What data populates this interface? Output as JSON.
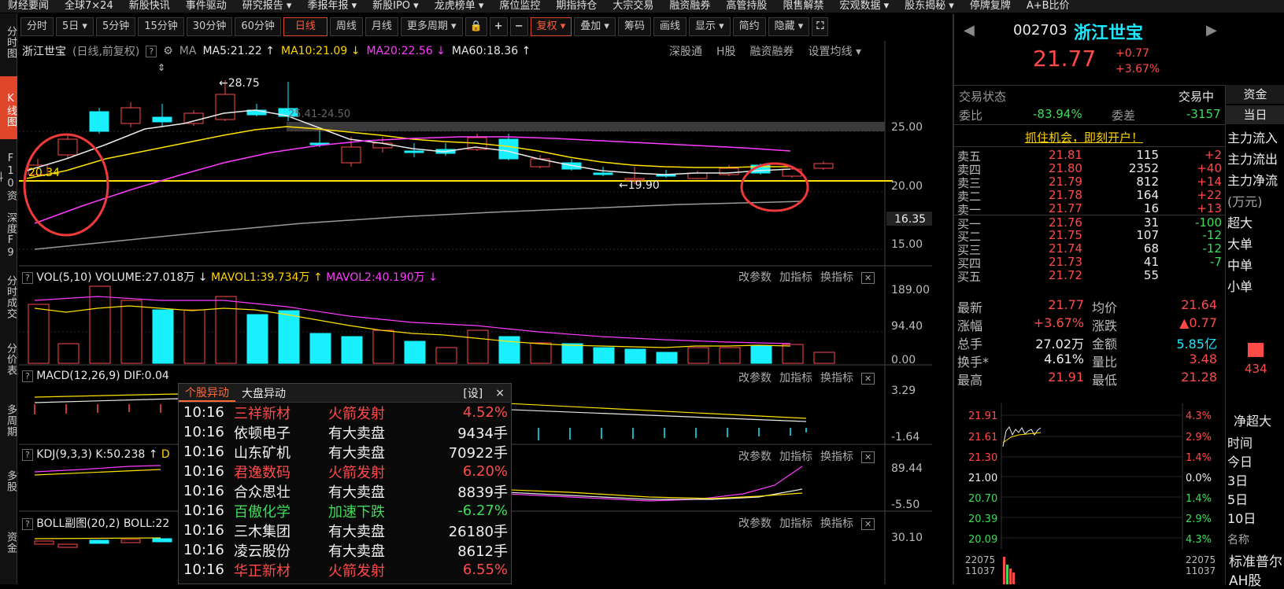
{
  "top_nav": [
    "财经要闻",
    "全球7×24",
    "新股快讯",
    "事件驱动",
    "研究报告 ▾",
    "季报年报 ▾",
    "新股IPO ▾",
    "龙虎榜单 ▾",
    "席位监控",
    "期指持仓",
    "大宗交易",
    "融资融券",
    "高管持股",
    "限售解禁",
    "宏观数据 ▾",
    "股东揭秘 ▾",
    "停牌复牌",
    "A+B比价"
  ],
  "left_tabs": [
    {
      "label": "分时图",
      "active": false
    },
    {
      "label": "K线图",
      "active": true
    },
    {
      "label": "F10资料",
      "active": false
    },
    {
      "label": "深度F9",
      "active": false
    },
    {
      "label": "分时成交",
      "active": false
    },
    {
      "label": "分价表",
      "active": false
    },
    {
      "label": "多周期",
      "active": false
    },
    {
      "label": "多股",
      "active": false
    },
    {
      "label": "资金",
      "active": false
    }
  ],
  "toolbar": [
    {
      "label": "分时",
      "active": false
    },
    {
      "label": "5日 ▾",
      "active": false
    },
    {
      "label": "5分钟",
      "active": false
    },
    {
      "label": "15分钟",
      "active": false
    },
    {
      "label": "30分钟",
      "active": false
    },
    {
      "label": "60分钟",
      "active": false
    },
    {
      "label": "日线",
      "active": true
    },
    {
      "label": "周线",
      "active": false
    },
    {
      "label": "月线",
      "active": false
    },
    {
      "label": "更多周期 ▾",
      "active": false
    },
    {
      "label": "🔒",
      "active": false
    },
    {
      "label": "+",
      "active": false
    },
    {
      "label": "−",
      "active": false
    },
    {
      "label": "复权 ▾",
      "active": true
    },
    {
      "label": "叠加 ▾",
      "active": false
    },
    {
      "label": "筹码",
      "active": false
    },
    {
      "label": "画线",
      "active": false
    },
    {
      "label": "显示 ▾",
      "active": false
    },
    {
      "label": "简约",
      "active": false
    },
    {
      "label": "隐藏 ▾",
      "active": false
    },
    {
      "label": "⛶",
      "active": false
    }
  ],
  "kline_header": {
    "name": "浙江世宝",
    "period": "(日线,前复权)",
    "ma_label": "MA",
    "ma5": "MA5:21.22 ↑",
    "ma10": "MA10:21.09 ↓",
    "ma20": "MA20:22.56 ↓",
    "ma60": "MA60:18.36 ↑",
    "links": [
      "深股通",
      "H股",
      "融资融券",
      "设置均线 ▾"
    ]
  },
  "kline_annotations": {
    "high": "←28.75",
    "low": "←19.90",
    "left": "20.34",
    "range": "25.41-24.50",
    "price_labels": [
      "25.00",
      "20.00",
      "16.35",
      "15.00"
    ]
  },
  "vol_panel": {
    "label": "VOL(5,10)",
    "volume": "VOLUME:27.018万 ↓",
    "mavol1": "MAVOL1:39.734万 ↑",
    "mavol2": "MAVOL2:40.190万 ↓",
    "axis": [
      "189.00",
      "94.40",
      "0.00"
    ]
  },
  "macd_panel": {
    "label": "MACD(12,26,9)",
    "dif": "DIF:0.04",
    "axis": [
      "3.29",
      "-1.64"
    ]
  },
  "kdj_panel": {
    "label": "KDJ(9,3,3)",
    "k": "K:50.238 ↑",
    "d": "D",
    "axis": [
      "89.44",
      "-5.50"
    ]
  },
  "boll_panel": {
    "label": "BOLL副图(20,2)",
    "boll": "BOLL:22",
    "axis": [
      "30.10"
    ]
  },
  "panel_buttons": [
    "改参数",
    "加指标",
    "换指标",
    "✕"
  ],
  "popup": {
    "tab_active": "个股异动",
    "tab2": "大盘异动",
    "set": "[设]",
    "close": "×",
    "rows": [
      {
        "time": "10:16",
        "name": "三祥新材",
        "event": "火箭发射",
        "value": "4.52%",
        "color": "red"
      },
      {
        "time": "10:16",
        "name": "依顿电子",
        "event": "有大卖盘",
        "value": "9434手",
        "color": "white"
      },
      {
        "time": "10:16",
        "name": "山东矿机",
        "event": "有大卖盘",
        "value": "70922手",
        "color": "white"
      },
      {
        "time": "10:16",
        "name": "君逸数码",
        "event": "火箭发射",
        "value": "6.20%",
        "color": "red"
      },
      {
        "time": "10:16",
        "name": "合众思壮",
        "event": "有大卖盘",
        "value": "8839手",
        "color": "white"
      },
      {
        "time": "10:16",
        "name": "百傲化学",
        "event": "加速下跌",
        "value": "-6.27%",
        "color": "green"
      },
      {
        "time": "10:16",
        "name": "三木集团",
        "event": "有大卖盘",
        "value": "26180手",
        "color": "white"
      },
      {
        "time": "10:16",
        "name": "凌云股份",
        "event": "有大卖盘",
        "value": "8612手",
        "color": "white"
      },
      {
        "time": "10:16",
        "name": "华正新材",
        "event": "火箭发射",
        "value": "6.55%",
        "color": "red"
      }
    ]
  },
  "quote": {
    "code": "002703",
    "name": "浙江世宝",
    "price": "21.77",
    "change": "+0.77",
    "pct": "+3.67%",
    "status_label": "交易状态",
    "status": "交易中",
    "wb_label": "委比",
    "wb": "-83.94%",
    "wc_label": "委差",
    "wc": "-3157",
    "promo": "抓住机会，即刻开户！"
  },
  "order_book": [
    {
      "label": "卖五",
      "price": "21.81",
      "vol": "115",
      "chg": "+2",
      "chg_color": "red"
    },
    {
      "label": "卖四",
      "price": "21.80",
      "vol": "2352",
      "chg": "+40",
      "chg_color": "red"
    },
    {
      "label": "卖三",
      "price": "21.79",
      "vol": "812",
      "chg": "+14",
      "chg_color": "red"
    },
    {
      "label": "卖二",
      "price": "21.78",
      "vol": "164",
      "chg": "+22",
      "chg_color": "red"
    },
    {
      "label": "卖一",
      "price": "21.77",
      "vol": "16",
      "chg": "+13",
      "chg_color": "red"
    },
    {
      "label": "买一",
      "price": "21.76",
      "vol": "31",
      "chg": "-100",
      "chg_color": "green"
    },
    {
      "label": "买二",
      "price": "21.75",
      "vol": "107",
      "chg": "-12",
      "chg_color": "green"
    },
    {
      "label": "买三",
      "price": "21.74",
      "vol": "68",
      "chg": "-12",
      "chg_color": "green"
    },
    {
      "label": "买四",
      "price": "21.73",
      "vol": "41",
      "chg": "-7",
      "chg_color": "green"
    },
    {
      "label": "买五",
      "price": "21.72",
      "vol": "55",
      "chg": "",
      "chg_color": "green"
    }
  ],
  "stats": [
    {
      "l1": "最新",
      "v1": "21.77",
      "c1": "red",
      "l2": "均价",
      "v2": "21.64",
      "c2": "red"
    },
    {
      "l1": "涨幅",
      "v1": "+3.67%",
      "c1": "red",
      "l2": "涨跌",
      "v2": "▲0.77",
      "c2": "red"
    },
    {
      "l1": "总手",
      "v1": "27.02万",
      "c1": "white",
      "l2": "金额",
      "v2": "5.85亿",
      "c2": "cyan"
    },
    {
      "l1": "换手*",
      "v1": "4.61%",
      "c1": "white",
      "l2": "量比",
      "v2": "3.48",
      "c2": "red"
    },
    {
      "l1": "最高",
      "v1": "21.91",
      "c1": "red",
      "l2": "最低",
      "v2": "21.28",
      "c2": "red"
    }
  ],
  "mini_chart": {
    "left_axis": [
      "21.91",
      "21.61",
      "21.30",
      "21.00",
      "20.70",
      "20.39",
      "20.09"
    ],
    "right_axis": [
      "4.3%",
      "2.9%",
      "1.4%",
      "0.0%",
      "1.4%",
      "2.9%",
      "4.3%"
    ],
    "vol_axis": [
      "22075",
      "11037"
    ]
  },
  "side": {
    "tab": "资金",
    "sub": "当日",
    "items": [
      "主力流入",
      "主力流出",
      "主力净流",
      "(万元)",
      "超大",
      "大单",
      "中单",
      "小单"
    ],
    "bar_value": "434",
    "net_label": "净超大",
    "time_label": "时间",
    "periods": [
      "今日",
      "3日",
      "5日",
      "10日"
    ],
    "name_label": "名称",
    "name_value": "标准普尔",
    "ah": "AH股"
  }
}
